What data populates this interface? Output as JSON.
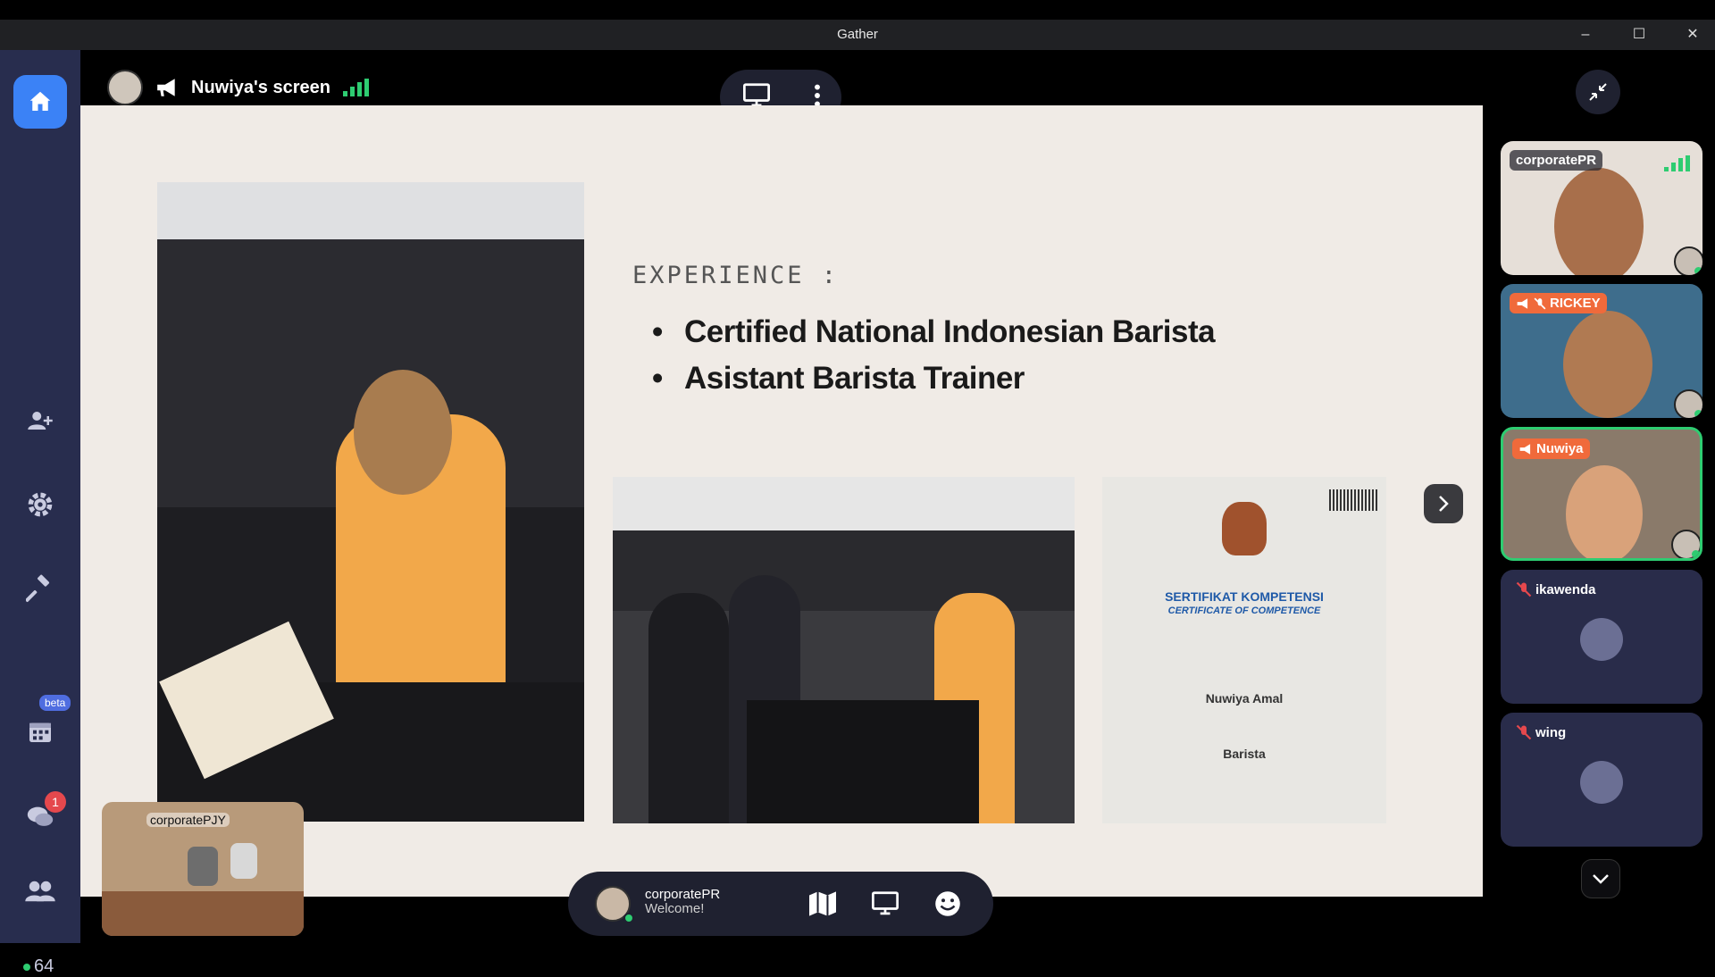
{
  "window": {
    "title": "Gather"
  },
  "sidebar": {
    "beta_label": "beta",
    "chat_badge": "1",
    "online_count": "64"
  },
  "screen_share": {
    "owner_label": "Nuwiya's screen"
  },
  "slide": {
    "heading": "EXPERIENCE :",
    "bullets": [
      "Certified National Indonesian Barista",
      "Asistant Barista Trainer"
    ],
    "certificate": {
      "title": "SERTIFIKAT KOMPETENSI",
      "subtitle": "CERTIFICATE OF COMPETENCE",
      "name": "Nuwiya Amal",
      "role": "Barista"
    }
  },
  "minimap": {
    "label": "corporatePJY"
  },
  "bottom_bar": {
    "user_name": "corporatePR",
    "status": "Welcome!"
  },
  "participants": [
    {
      "name": "corporatePR"
    },
    {
      "name": "RICKEY"
    },
    {
      "name": "Nuwiya"
    },
    {
      "name": "ikawenda"
    },
    {
      "name": "wing"
    }
  ],
  "colors": {
    "accent": "#3b82f6",
    "speaking": "#f06a3b",
    "online": "#2ecc71",
    "sidebar": "#282d4e"
  }
}
